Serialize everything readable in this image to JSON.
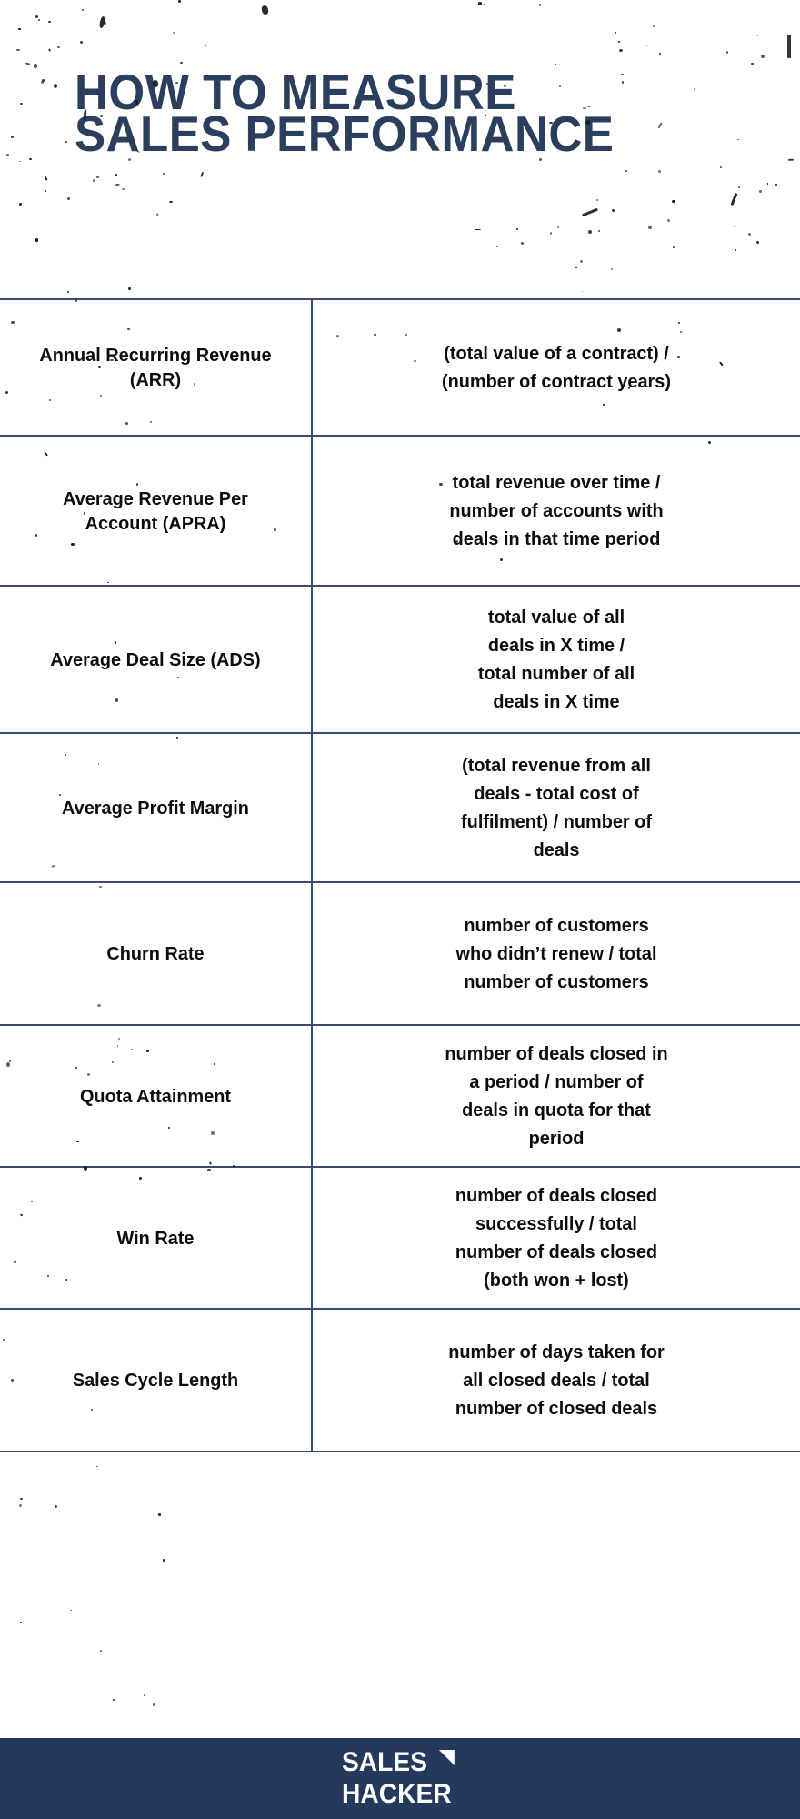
{
  "header": {
    "title": "HOW TO MEASURE\nSALES PERFORMANCE"
  },
  "table": {
    "rows": [
      {
        "metric": "Annual Recurring Revenue\n(ARR)",
        "formula": "(total value of a contract) /\n(number of contract years)"
      },
      {
        "metric": "Average Revenue Per\nAccount (APRA)",
        "formula": "total revenue over time /\nnumber of accounts with\ndeals in that time period"
      },
      {
        "metric": "Average Deal Size (ADS)",
        "formula": "total value of all\ndeals in X time /\ntotal number of all\ndeals in X time"
      },
      {
        "metric": "Average Profit Margin",
        "formula": "(total revenue from all\ndeals - total cost of\nfulfilment) / number of\ndeals"
      },
      {
        "metric": "Churn Rate",
        "formula": "number of customers\nwho didn’t renew / total\nnumber of customers"
      },
      {
        "metric": "Quota Attainment",
        "formula": "number of deals closed in\na period / number of\ndeals in quota for that\nperiod"
      },
      {
        "metric": "Win Rate",
        "formula": "number of deals closed\nsuccessfully / total\nnumber of deals closed\n(both won + lost)"
      },
      {
        "metric": "Sales Cycle Length",
        "formula": "number of days taken for\nall closed deals / total\nnumber of closed deals"
      }
    ]
  },
  "footer": {
    "logo_line1": "SALES",
    "logo_line2": "HACKER"
  },
  "colors": {
    "title_navy": "#2C3E5D",
    "border_blue": "#3A4B6E",
    "footer_navy": "#243A5C",
    "body_text": "#0b0d10",
    "background": "#ffffff"
  }
}
